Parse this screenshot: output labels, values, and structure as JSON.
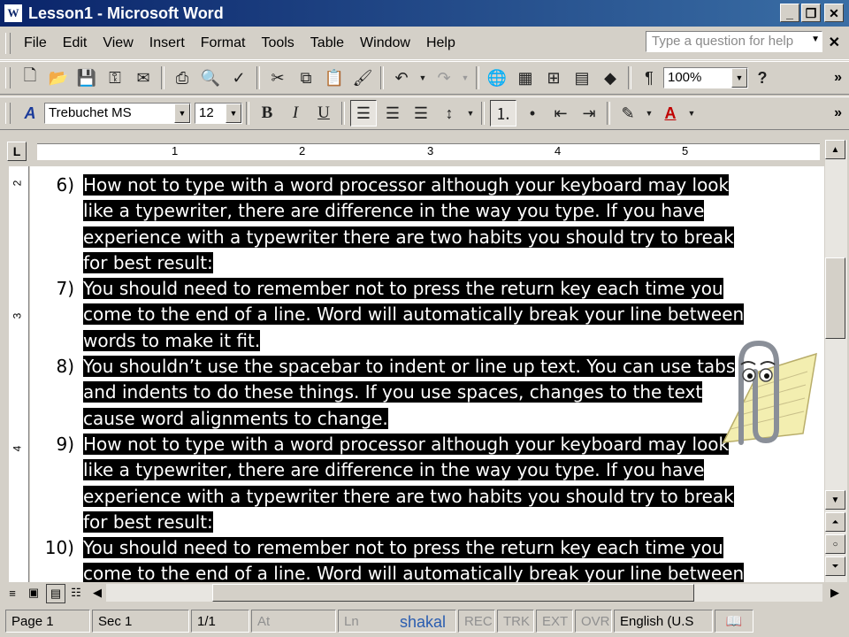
{
  "window": {
    "title": "Lesson1 - Microsoft Word"
  },
  "menu": [
    "File",
    "Edit",
    "View",
    "Insert",
    "Format",
    "Tools",
    "Table",
    "Window",
    "Help"
  ],
  "help_box": {
    "placeholder": "Type a question for help"
  },
  "toolbar": {
    "zoom": "100%",
    "font": "Trebuchet MS",
    "size": "12"
  },
  "ruler": {
    "numbers": [
      "1",
      "2",
      "3",
      "4",
      "5"
    ],
    "vertical": [
      "2",
      "3",
      "4"
    ]
  },
  "document": {
    "items": [
      {
        "num": "6)",
        "lines": [
          "How not to type with a word processor although your keyboard may look",
          "like a typewriter, there are difference in the way you type. If you have",
          "experience with a typewriter there are two habits you should try to break",
          "for best result:"
        ]
      },
      {
        "num": "7)",
        "lines": [
          "You should need to remember not to press the return key each time you",
          "come to the end of a line. Word will automatically break your line between",
          "words to make it fit."
        ]
      },
      {
        "num": "8)",
        "lines": [
          "You shouldn’t use the spacebar to indent or line up text. You can use tabs",
          "and indents to do these things. If you use spaces, changes to the text",
          "cause word alignments to change."
        ]
      },
      {
        "num": "9)",
        "lines": [
          "How not to type with a word processor although your keyboard may look",
          "like a typewriter, there are difference in the way you type. If you have",
          "experience with a typewriter there are two habits you should try to break",
          "for best result:"
        ]
      },
      {
        "num": "10)",
        "lines": [
          "You should need to remember not to press the return key each time you",
          "come to the end of a line. Word will automatically break your line between"
        ]
      }
    ]
  },
  "status": {
    "page": "Page 1",
    "sec": "Sec 1",
    "pages": "1/1",
    "at": "At",
    "ln": "Ln",
    "rec": "REC",
    "trk": "TRK",
    "ext": "EXT",
    "ovr": "OVR",
    "lang": "English (U.S"
  },
  "watermark": "shakal"
}
